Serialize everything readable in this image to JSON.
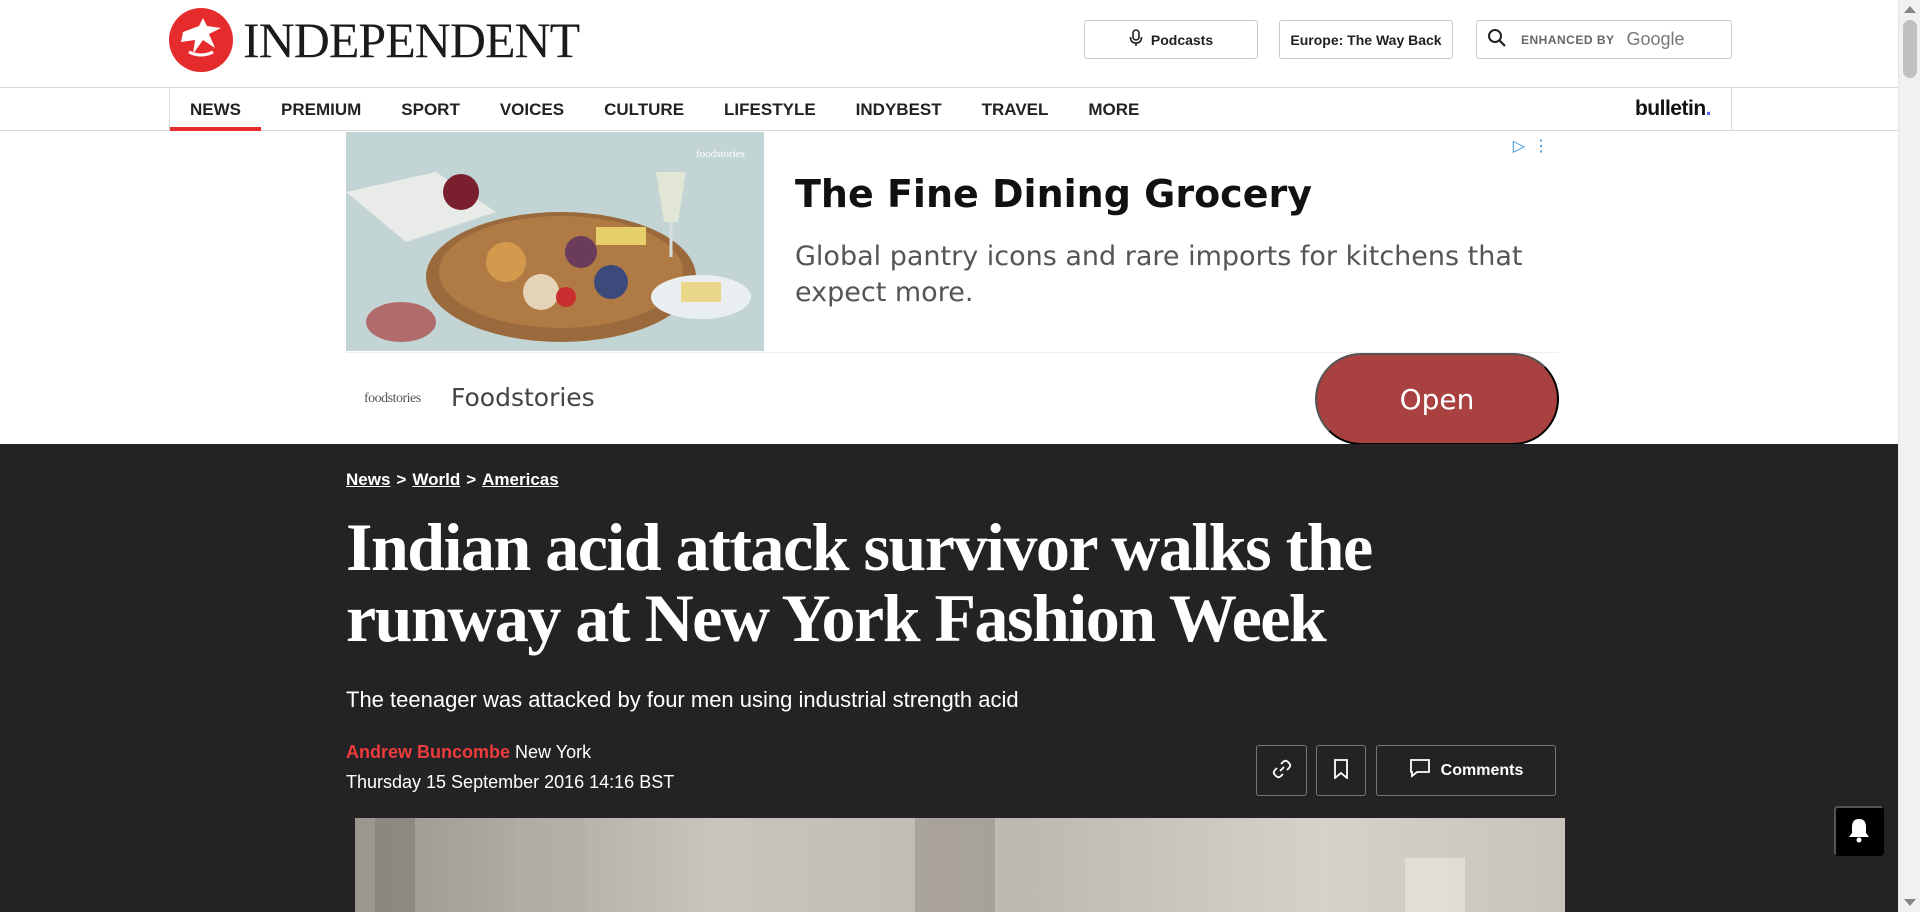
{
  "site": {
    "logo_text": "INDEPENDENT"
  },
  "header": {
    "podcasts_label": "Podcasts",
    "europe_label": "Europe: The Way Back",
    "search": {
      "enhanced_by": "ENHANCED BY",
      "google": "Google"
    }
  },
  "nav": {
    "items": [
      {
        "label": "NEWS",
        "active": true
      },
      {
        "label": "PREMIUM"
      },
      {
        "label": "SPORT"
      },
      {
        "label": "VOICES"
      },
      {
        "label": "CULTURE"
      },
      {
        "label": "LIFESTYLE"
      },
      {
        "label": "INDYBEST"
      },
      {
        "label": "TRAVEL"
      },
      {
        "label": "MORE"
      }
    ],
    "bulletin": "bulletin",
    "bulletin_dot": "."
  },
  "ad": {
    "title": "The Fine Dining Grocery",
    "description": "Global pantry icons and rare imports for kitchens that expect more.",
    "brand_logo_text": "foodstories",
    "brand": "Foodstories",
    "cta": "Open",
    "cta_color": "#a84140"
  },
  "article": {
    "breadcrumbs": [
      "News",
      "World",
      "Americas"
    ],
    "breadcrumb_separator": ">",
    "headline": "Indian acid attack survivor walks the runway at New York Fashion Week",
    "standfirst": "The teenager was attacked by four men using industrial strength acid",
    "author": "Andrew Buncombe",
    "location": "New York",
    "dateline": "Thursday 15 September 2016 14:16 BST",
    "comments_label": "Comments"
  },
  "colors": {
    "brand_red": "#e52b2b",
    "article_bg": "#232224",
    "author_red": "#ee3b3b"
  }
}
